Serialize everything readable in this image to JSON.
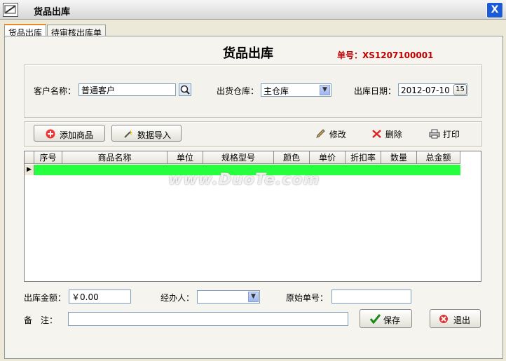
{
  "window": {
    "title": "货品出库",
    "close_glyph": "X"
  },
  "tabs": [
    {
      "label": "货品出库"
    },
    {
      "label": "待审核出库单"
    }
  ],
  "form": {
    "heading": "货品出库",
    "order_number": "单号：XS1207100001",
    "customer_label": "客户名称：",
    "customer_value": "普通客户",
    "warehouse_label": "出货仓库：",
    "warehouse_value": "主仓库",
    "date_label": "出库日期：",
    "date_value": "2012-07-10",
    "date_button": "15"
  },
  "toolbar": {
    "add_label": "添加商品",
    "import_label": "数据导入",
    "edit_label": "修改",
    "delete_label": "删除",
    "print_label": "打印"
  },
  "table": {
    "columns": [
      "序号",
      "商品名称",
      "单位",
      "规格型号",
      "颜色",
      "单价",
      "折扣率",
      "数量",
      "总金额"
    ]
  },
  "footer": {
    "amount_label": "出库金额：",
    "amount_value": "￥0.00",
    "handler_label": "经办人：",
    "handler_value": "",
    "source_label": "原始单号：",
    "source_value": "",
    "remark_label": "备　注：",
    "remark_value": "",
    "save_label": "保存",
    "exit_label": "退出"
  },
  "watermark": "www.DuoTe.com",
  "colors": {
    "order_number": "#c00000",
    "selected_row": "#26ff3d",
    "titlebar_close": "#1c5bd8"
  }
}
